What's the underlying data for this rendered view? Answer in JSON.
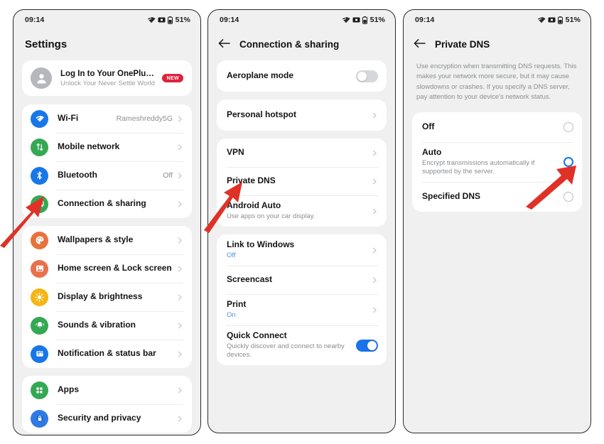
{
  "status_bar": {
    "time": "09:14",
    "battery": "51%",
    "icons": [
      "wifi-icon",
      "vibrate-icon",
      "battery-icon"
    ]
  },
  "colors": {
    "accent_blue": "#1a73e8",
    "badge_red": "#e0213c",
    "arrow_red": "#e03127",
    "link_blue": "#4a90d9",
    "screen_bg": "#f0f0f0",
    "card_bg": "#ffffff"
  },
  "panel1": {
    "title": "Settings",
    "account": {
      "title": "Log In to Your OnePlus Ac...",
      "subtitle": "Unlock Your Never Settle World",
      "badge": "NEW"
    },
    "groups": [
      {
        "items": [
          {
            "label": "Wi-Fi",
            "value": "Rameshreddy5G",
            "icon": "wifi-icon",
            "color": "#1877e8"
          },
          {
            "label": "Mobile network",
            "value": "",
            "icon": "mobile-network-icon",
            "color": "#34a853"
          },
          {
            "label": "Bluetooth",
            "value": "Off",
            "icon": "bluetooth-icon",
            "color": "#1877e8"
          },
          {
            "label": "Connection & sharing",
            "value": "",
            "icon": "connection-sharing-icon",
            "color": "#34a853"
          }
        ]
      },
      {
        "items": [
          {
            "label": "Wallpapers & style",
            "value": "",
            "icon": "palette-icon",
            "color": "#e8713c"
          },
          {
            "label": "Home screen & Lock screen",
            "value": "",
            "icon": "image-icon",
            "color": "#e8714c"
          },
          {
            "label": "Display & brightness",
            "value": "",
            "icon": "brightness-icon",
            "color": "#f5b512"
          },
          {
            "label": "Sounds & vibration",
            "value": "",
            "icon": "bell-icon",
            "color": "#34a853"
          },
          {
            "label": "Notification & status bar",
            "value": "",
            "icon": "notification-icon",
            "color": "#1877e8"
          }
        ]
      },
      {
        "items": [
          {
            "label": "Apps",
            "value": "",
            "icon": "apps-grid-icon",
            "color": "#34a853"
          },
          {
            "label": "Security and privacy",
            "value": "",
            "icon": "lock-shield-icon",
            "color": "#2f7ae5"
          }
        ]
      }
    ]
  },
  "panel2": {
    "title": "Connection & sharing",
    "back_icon": "back-arrow-icon",
    "groups": [
      {
        "items": [
          {
            "label": "Aeroplane mode",
            "sub": "",
            "control": "toggle",
            "on": false
          }
        ]
      },
      {
        "items": [
          {
            "label": "Personal hotspot",
            "sub": "",
            "control": "chevron"
          }
        ]
      },
      {
        "items": [
          {
            "label": "VPN",
            "sub": "",
            "control": "chevron"
          },
          {
            "label": "Private DNS",
            "sub": "",
            "control": "chevron"
          },
          {
            "label": "Android Auto",
            "sub": "Use apps on your car display.",
            "control": "chevron"
          }
        ]
      },
      {
        "items": [
          {
            "label": "Link to Windows",
            "sub": "Off",
            "sub_style": "blue",
            "control": "chevron"
          },
          {
            "label": "Screencast",
            "sub": "",
            "control": "chevron"
          },
          {
            "label": "Print",
            "sub": "On",
            "sub_style": "blue",
            "control": "chevron"
          },
          {
            "label": "Quick Connect",
            "sub": "Quickly discover and connect to nearby devices.",
            "control": "toggle",
            "on": true
          }
        ]
      }
    ]
  },
  "panel3": {
    "title": "Private DNS",
    "back_icon": "back-arrow-icon",
    "description": "Use encryption when transmitting DNS requests. This makes your network more secure, but it may cause slowdowns or crashes. If you specify a DNS server, pay attention to your device's network status.",
    "options": [
      {
        "label": "Off",
        "sub": "",
        "selected": false
      },
      {
        "label": "Auto",
        "sub": "Encrypt transmissions automatically if supported by the server.",
        "selected": true
      },
      {
        "label": "Specified DNS",
        "sub": "",
        "selected": false
      }
    ]
  },
  "annotations": [
    {
      "name": "arrow-to-connection-sharing",
      "points_at": "Connection & sharing"
    },
    {
      "name": "arrow-to-private-dns",
      "points_at": "Private DNS"
    },
    {
      "name": "arrow-to-auto-radio",
      "points_at": "Auto"
    }
  ]
}
